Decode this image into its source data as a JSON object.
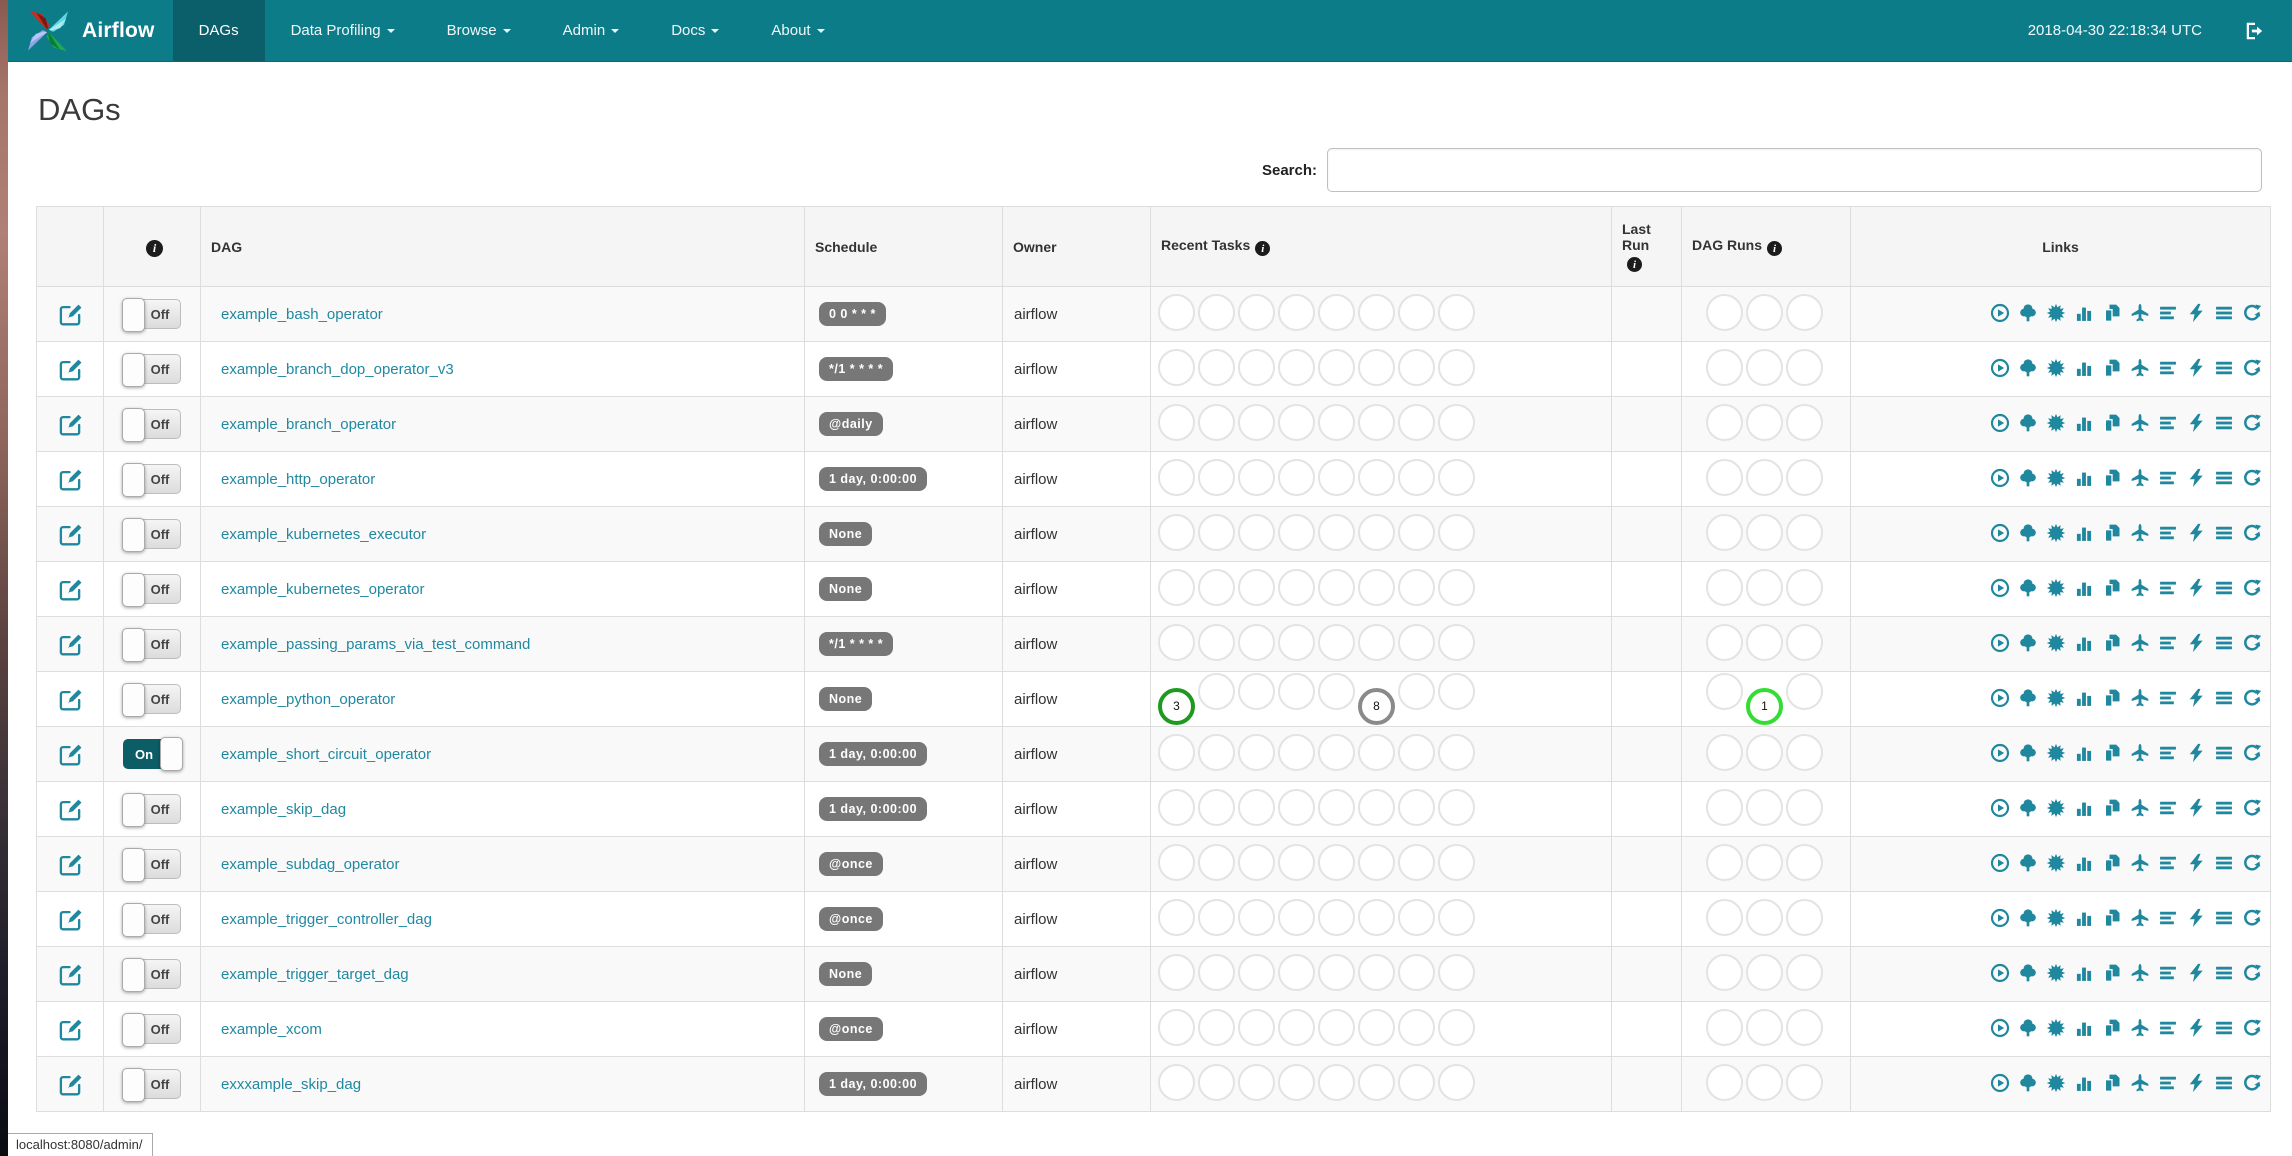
{
  "navbar": {
    "brand": "Airflow",
    "items": [
      {
        "label": "DAGs",
        "active": true,
        "caret": false
      },
      {
        "label": "Data Profiling",
        "active": false,
        "caret": true
      },
      {
        "label": "Browse",
        "active": false,
        "caret": true
      },
      {
        "label": "Admin",
        "active": false,
        "caret": true
      },
      {
        "label": "Docs",
        "active": false,
        "caret": true
      },
      {
        "label": "About",
        "active": false,
        "caret": true
      }
    ],
    "clock": "2018-04-30 22:18:34 UTC"
  },
  "page": {
    "title": "DAGs",
    "search_label": "Search:",
    "search_value": "",
    "status_bar": "localhost:8080/admin/"
  },
  "colors": {
    "navbar": "#0d7c89",
    "navbar_active": "#0a5f6b",
    "link_teal": "#2089a1",
    "toggle_on": "#0c5d66",
    "schedule_badge": "#777777",
    "task_success": "#1f9a1f",
    "task_gray": "#8a8a8a",
    "run_running": "#33dd33",
    "circle_empty_border": "#e3e3e3"
  },
  "table": {
    "headers": {
      "edit": "",
      "info": "",
      "dag": "DAG",
      "schedule": "Schedule",
      "owner": "Owner",
      "recent_tasks": "Recent Tasks",
      "last_run": "Last Run",
      "dag_runs": "DAG Runs",
      "links": "Links"
    },
    "recent_task_slots": 8,
    "dag_run_slots": 3,
    "link_icons": [
      "trigger-dag",
      "tree-view",
      "graph-view",
      "task-duration",
      "task-tries",
      "landing-times",
      "gantt",
      "code-view",
      "logs",
      "refresh"
    ],
    "rows": [
      {
        "name": "example_bash_operator",
        "toggle": "Off",
        "schedule": "0 0 * * *",
        "owner": "airflow",
        "last_run": "",
        "recent_tasks": [],
        "dag_runs": []
      },
      {
        "name": "example_branch_dop_operator_v3",
        "toggle": "Off",
        "schedule": "*/1 * * * *",
        "owner": "airflow",
        "last_run": "",
        "recent_tasks": [],
        "dag_runs": []
      },
      {
        "name": "example_branch_operator",
        "toggle": "Off",
        "schedule": "@daily",
        "owner": "airflow",
        "last_run": "",
        "recent_tasks": [],
        "dag_runs": []
      },
      {
        "name": "example_http_operator",
        "toggle": "Off",
        "schedule": "1 day, 0:00:00",
        "owner": "airflow",
        "last_run": "",
        "recent_tasks": [],
        "dag_runs": []
      },
      {
        "name": "example_kubernetes_executor",
        "toggle": "Off",
        "schedule": "None",
        "owner": "airflow",
        "last_run": "",
        "recent_tasks": [],
        "dag_runs": []
      },
      {
        "name": "example_kubernetes_operator",
        "toggle": "Off",
        "schedule": "None",
        "owner": "airflow",
        "last_run": "",
        "recent_tasks": [],
        "dag_runs": []
      },
      {
        "name": "example_passing_params_via_test_command",
        "toggle": "Off",
        "schedule": "*/1 * * * *",
        "owner": "airflow",
        "last_run": "",
        "recent_tasks": [],
        "dag_runs": []
      },
      {
        "name": "example_python_operator",
        "toggle": "Off",
        "schedule": "None",
        "owner": "airflow",
        "last_run": "",
        "recent_tasks": [
          {
            "slot": 0,
            "count": "3",
            "color": "#1f9a1f"
          },
          {
            "slot": 5,
            "count": "8",
            "color": "#8a8a8a"
          }
        ],
        "dag_runs": [
          {
            "slot": 1,
            "count": "1",
            "color": "#33dd33"
          }
        ]
      },
      {
        "name": "example_short_circuit_operator",
        "toggle": "On",
        "schedule": "1 day, 0:00:00",
        "owner": "airflow",
        "last_run": "",
        "recent_tasks": [],
        "dag_runs": []
      },
      {
        "name": "example_skip_dag",
        "toggle": "Off",
        "schedule": "1 day, 0:00:00",
        "owner": "airflow",
        "last_run": "",
        "recent_tasks": [],
        "dag_runs": []
      },
      {
        "name": "example_subdag_operator",
        "toggle": "Off",
        "schedule": "@once",
        "owner": "airflow",
        "last_run": "",
        "recent_tasks": [],
        "dag_runs": []
      },
      {
        "name": "example_trigger_controller_dag",
        "toggle": "Off",
        "schedule": "@once",
        "owner": "airflow",
        "last_run": "",
        "recent_tasks": [],
        "dag_runs": []
      },
      {
        "name": "example_trigger_target_dag",
        "toggle": "Off",
        "schedule": "None",
        "owner": "airflow",
        "last_run": "",
        "recent_tasks": [],
        "dag_runs": []
      },
      {
        "name": "example_xcom",
        "toggle": "Off",
        "schedule": "@once",
        "owner": "airflow",
        "last_run": "",
        "recent_tasks": [],
        "dag_runs": []
      },
      {
        "name": "exxxample_skip_dag",
        "toggle": "Off",
        "schedule": "1 day, 0:00:00",
        "owner": "airflow",
        "last_run": "",
        "recent_tasks": [],
        "dag_runs": []
      }
    ]
  }
}
